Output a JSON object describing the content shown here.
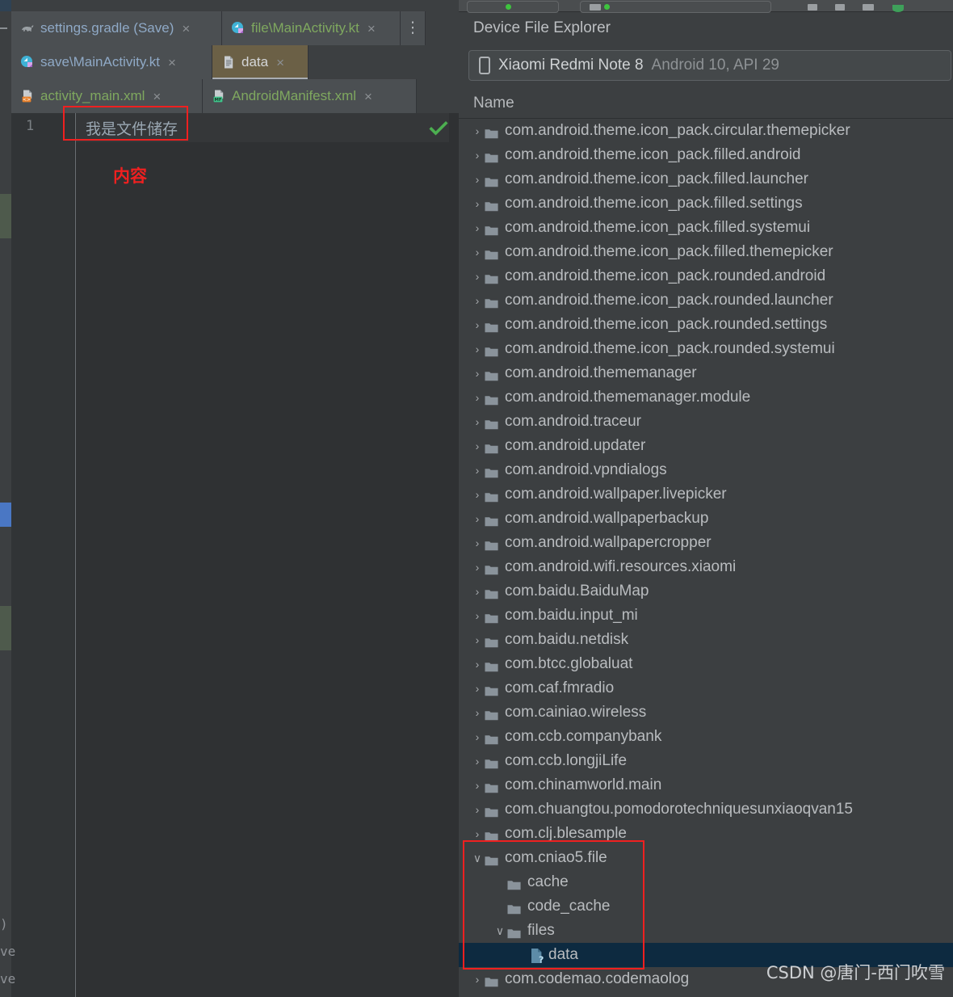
{
  "editor": {
    "tab_rows": [
      [
        {
          "label": "settings.gradle (Save)",
          "icon": "gradle-elephant-icon",
          "color": "blue",
          "selected": false,
          "close": "×"
        },
        {
          "label": "file\\MainActivity.kt",
          "icon": "kotlin-icon",
          "color": "green",
          "selected": false,
          "close": "×"
        }
      ],
      [
        {
          "label": "save\\MainActivity.kt",
          "icon": "kotlin-icon",
          "color": "blue",
          "selected": false,
          "close": "×"
        },
        {
          "label": "data",
          "icon": "textfile-icon",
          "color": "plain",
          "selected": true,
          "close": "×"
        }
      ],
      [
        {
          "label": "activity_main.xml",
          "icon": "layout-xml-icon",
          "color": "green",
          "selected": false,
          "close": "×"
        },
        {
          "label": "AndroidManifest.xml",
          "icon": "manifest-xml-icon",
          "color": "green",
          "selected": false,
          "close": "×"
        }
      ]
    ],
    "kebab_label": "⋮",
    "line_number": "1",
    "line_content": "我是文件储存",
    "annotation": "内容",
    "validation_icon": "green-checkmark-icon",
    "left_fragments": [
      ")",
      "ve",
      "ve"
    ]
  },
  "device_file_explorer": {
    "title": "Device File Explorer",
    "device": {
      "name": "Xiaomi Redmi Note 8",
      "api": "Android 10, API 29",
      "icon": "phone-icon"
    },
    "column_header": "Name",
    "rows": [
      {
        "name": "com.android.theme.icon_pack.circular.themepicker",
        "type": "folder",
        "indent": 0,
        "expandable": true,
        "expanded": false,
        "selected": false
      },
      {
        "name": "com.android.theme.icon_pack.filled.android",
        "type": "folder",
        "indent": 0,
        "expandable": true,
        "expanded": false,
        "selected": false
      },
      {
        "name": "com.android.theme.icon_pack.filled.launcher",
        "type": "folder",
        "indent": 0,
        "expandable": true,
        "expanded": false,
        "selected": false
      },
      {
        "name": "com.android.theme.icon_pack.filled.settings",
        "type": "folder",
        "indent": 0,
        "expandable": true,
        "expanded": false,
        "selected": false
      },
      {
        "name": "com.android.theme.icon_pack.filled.systemui",
        "type": "folder",
        "indent": 0,
        "expandable": true,
        "expanded": false,
        "selected": false
      },
      {
        "name": "com.android.theme.icon_pack.filled.themepicker",
        "type": "folder",
        "indent": 0,
        "expandable": true,
        "expanded": false,
        "selected": false
      },
      {
        "name": "com.android.theme.icon_pack.rounded.android",
        "type": "folder",
        "indent": 0,
        "expandable": true,
        "expanded": false,
        "selected": false
      },
      {
        "name": "com.android.theme.icon_pack.rounded.launcher",
        "type": "folder",
        "indent": 0,
        "expandable": true,
        "expanded": false,
        "selected": false
      },
      {
        "name": "com.android.theme.icon_pack.rounded.settings",
        "type": "folder",
        "indent": 0,
        "expandable": true,
        "expanded": false,
        "selected": false
      },
      {
        "name": "com.android.theme.icon_pack.rounded.systemui",
        "type": "folder",
        "indent": 0,
        "expandable": true,
        "expanded": false,
        "selected": false
      },
      {
        "name": "com.android.thememanager",
        "type": "folder",
        "indent": 0,
        "expandable": true,
        "expanded": false,
        "selected": false
      },
      {
        "name": "com.android.thememanager.module",
        "type": "folder",
        "indent": 0,
        "expandable": true,
        "expanded": false,
        "selected": false
      },
      {
        "name": "com.android.traceur",
        "type": "folder",
        "indent": 0,
        "expandable": true,
        "expanded": false,
        "selected": false
      },
      {
        "name": "com.android.updater",
        "type": "folder",
        "indent": 0,
        "expandable": true,
        "expanded": false,
        "selected": false
      },
      {
        "name": "com.android.vpndialogs",
        "type": "folder",
        "indent": 0,
        "expandable": true,
        "expanded": false,
        "selected": false
      },
      {
        "name": "com.android.wallpaper.livepicker",
        "type": "folder",
        "indent": 0,
        "expandable": true,
        "expanded": false,
        "selected": false
      },
      {
        "name": "com.android.wallpaperbackup",
        "type": "folder",
        "indent": 0,
        "expandable": true,
        "expanded": false,
        "selected": false
      },
      {
        "name": "com.android.wallpapercropper",
        "type": "folder",
        "indent": 0,
        "expandable": true,
        "expanded": false,
        "selected": false
      },
      {
        "name": "com.android.wifi.resources.xiaomi",
        "type": "folder",
        "indent": 0,
        "expandable": true,
        "expanded": false,
        "selected": false
      },
      {
        "name": "com.baidu.BaiduMap",
        "type": "folder",
        "indent": 0,
        "expandable": true,
        "expanded": false,
        "selected": false
      },
      {
        "name": "com.baidu.input_mi",
        "type": "folder",
        "indent": 0,
        "expandable": true,
        "expanded": false,
        "selected": false
      },
      {
        "name": "com.baidu.netdisk",
        "type": "folder",
        "indent": 0,
        "expandable": true,
        "expanded": false,
        "selected": false
      },
      {
        "name": "com.btcc.globaluat",
        "type": "folder",
        "indent": 0,
        "expandable": true,
        "expanded": false,
        "selected": false
      },
      {
        "name": "com.caf.fmradio",
        "type": "folder",
        "indent": 0,
        "expandable": true,
        "expanded": false,
        "selected": false
      },
      {
        "name": "com.cainiao.wireless",
        "type": "folder",
        "indent": 0,
        "expandable": true,
        "expanded": false,
        "selected": false
      },
      {
        "name": "com.ccb.companybank",
        "type": "folder",
        "indent": 0,
        "expandable": true,
        "expanded": false,
        "selected": false
      },
      {
        "name": "com.ccb.longjiLife",
        "type": "folder",
        "indent": 0,
        "expandable": true,
        "expanded": false,
        "selected": false
      },
      {
        "name": "com.chinamworld.main",
        "type": "folder",
        "indent": 0,
        "expandable": true,
        "expanded": false,
        "selected": false
      },
      {
        "name": "com.chuangtou.pomodorotechniquesunxiaoqvan15",
        "type": "folder",
        "indent": 0,
        "expandable": true,
        "expanded": false,
        "selected": false
      },
      {
        "name": "com.clj.blesample",
        "type": "folder",
        "indent": 0,
        "expandable": true,
        "expanded": false,
        "selected": false
      },
      {
        "name": "com.cniao5.file",
        "type": "folder",
        "indent": 0,
        "expandable": true,
        "expanded": true,
        "selected": false
      },
      {
        "name": "cache",
        "type": "folder",
        "indent": 1,
        "expandable": false,
        "expanded": false,
        "selected": false
      },
      {
        "name": "code_cache",
        "type": "folder",
        "indent": 1,
        "expandable": false,
        "expanded": false,
        "selected": false
      },
      {
        "name": "files",
        "type": "folder",
        "indent": 1,
        "expandable": true,
        "expanded": true,
        "selected": false
      },
      {
        "name": "data",
        "type": "unknown-file",
        "indent": 2,
        "expandable": false,
        "expanded": false,
        "selected": true
      },
      {
        "name": "com.codemao.codemaolog",
        "type": "folder",
        "indent": 0,
        "expandable": true,
        "expanded": false,
        "selected": false
      }
    ]
  },
  "watermark": "CSDN @唐门-西门吹雪",
  "colors": {
    "annotation_red": "#ef2020",
    "selection_navy": "#0d2a40",
    "panel_bg": "#3c3f41",
    "editor_bg": "#2f3133",
    "tab_bg": "#4b4f52",
    "tab_selected_bg": "#6b6046",
    "folder_icon": "#8a939b",
    "green_check": "#4caf50"
  }
}
